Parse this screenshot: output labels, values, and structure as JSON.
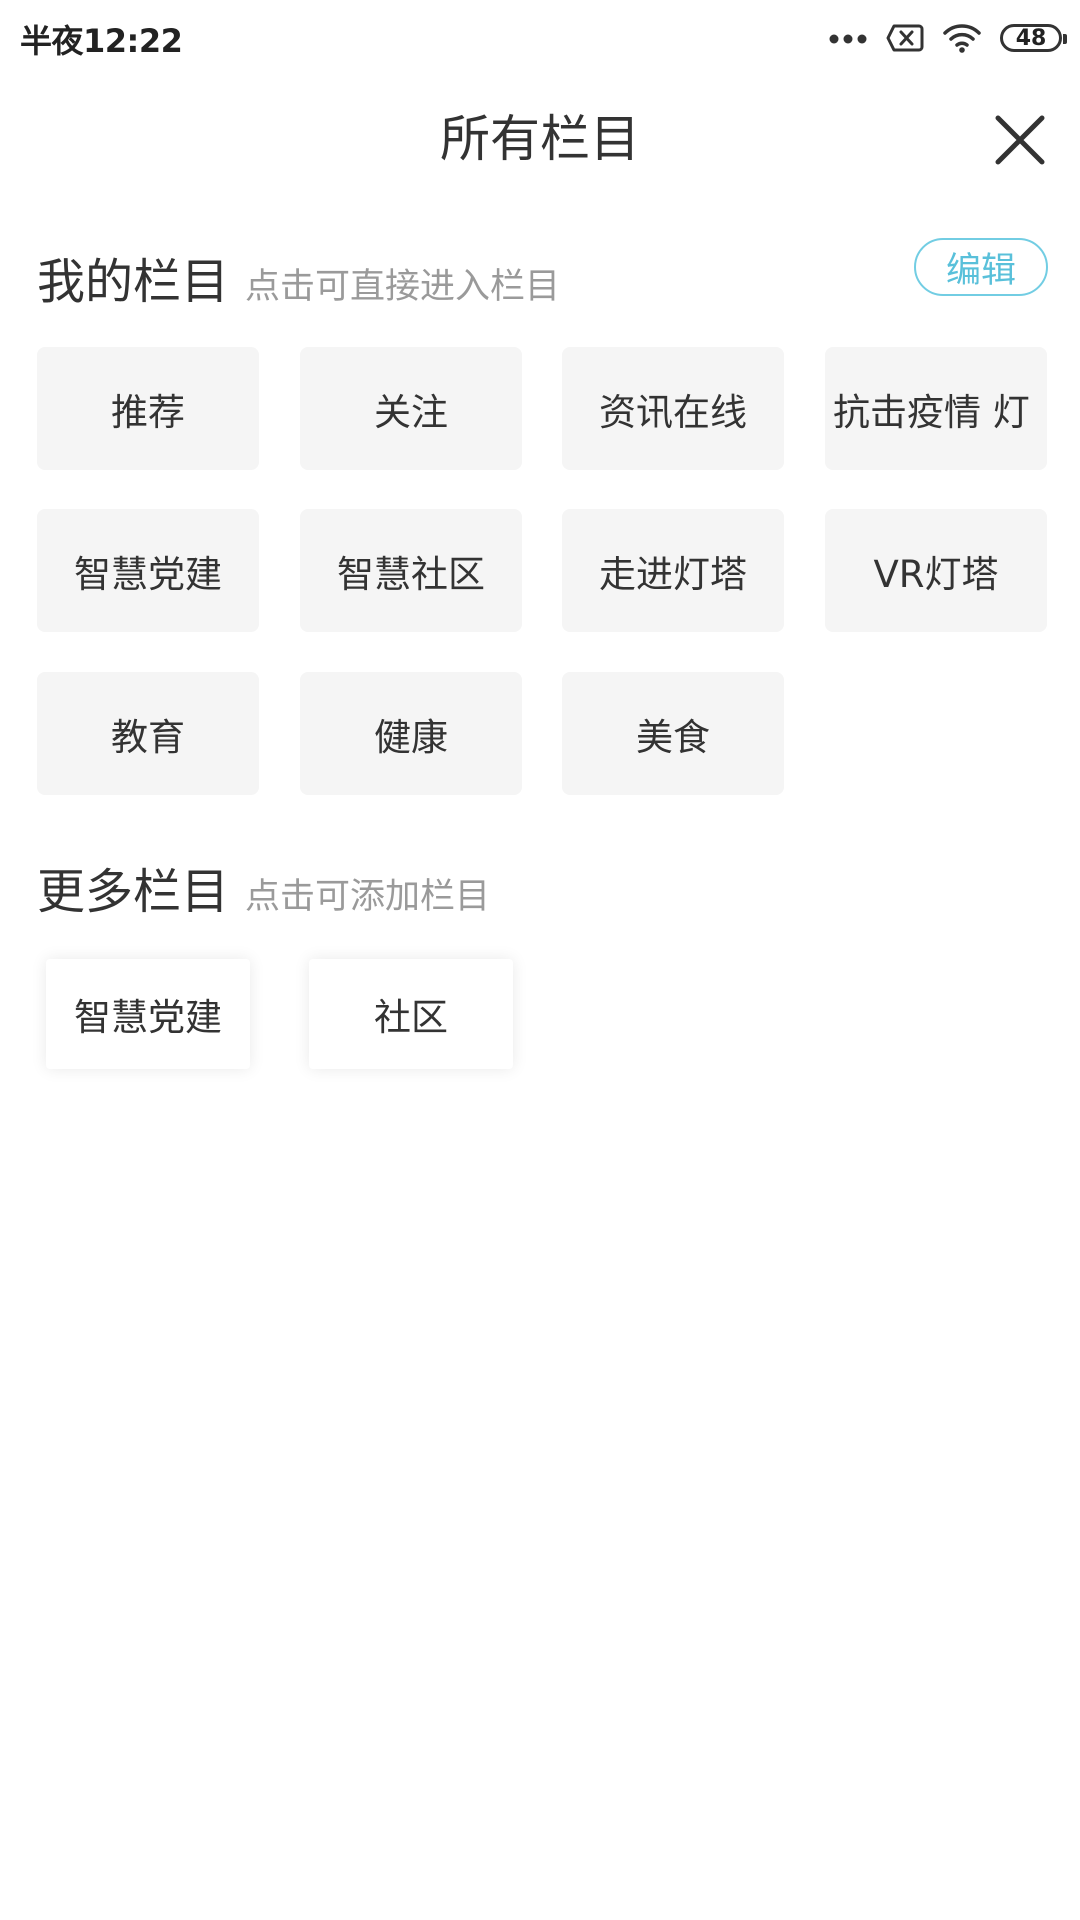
{
  "status_bar": {
    "time": "半夜12:22",
    "battery": "48",
    "icons": [
      "more-dots-icon",
      "sim-off-icon",
      "wifi-icon",
      "battery-icon"
    ]
  },
  "header": {
    "title": "所有栏目",
    "close_icon": "close-icon"
  },
  "my_columns": {
    "title": "我的栏目",
    "hint": "点击可直接进入栏目",
    "edit_label": "编辑",
    "items": [
      "推荐",
      "关注",
      "资讯在线",
      "抗击疫情 灯",
      "智慧党建",
      "智慧社区",
      "走进灯塔",
      "VR灯塔",
      "教育",
      "健康",
      "美食"
    ]
  },
  "more_columns": {
    "title": "更多栏目",
    "hint": "点击可添加栏目",
    "items": [
      "智慧党建",
      "社区"
    ]
  },
  "colors": {
    "accent": "#59c0da",
    "tile_bg": "#f5f5f5",
    "text": "#333333",
    "hint": "#9a9a9a"
  }
}
